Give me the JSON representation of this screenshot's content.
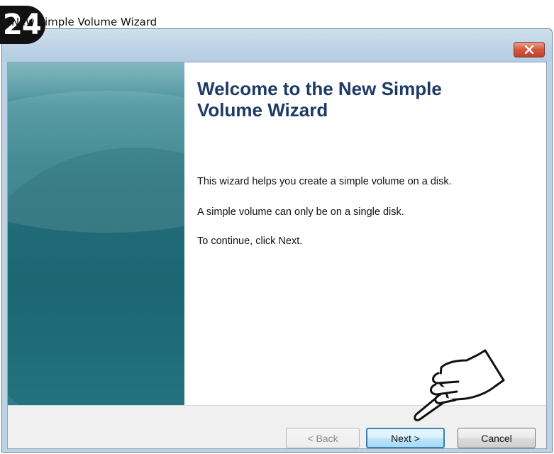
{
  "step_badge": "24",
  "window": {
    "title": "New Simple Volume Wizard"
  },
  "wizard": {
    "heading": "Welcome to the New Simple Volume Wizard",
    "paragraphs": [
      "This wizard helps you create a simple volume on a disk.",
      "A simple volume can only be on a single disk.",
      "To continue, click Next."
    ]
  },
  "buttons": {
    "back": "< Back",
    "next": "Next >",
    "cancel": "Cancel"
  },
  "icons": {
    "close": "close-icon",
    "hand": "pointing-hand-icon"
  },
  "colors": {
    "heading": "#1e3a66",
    "side_panel": "#2f7e8a",
    "close_button": "#d4573b",
    "next_border": "#3c7fb1"
  }
}
